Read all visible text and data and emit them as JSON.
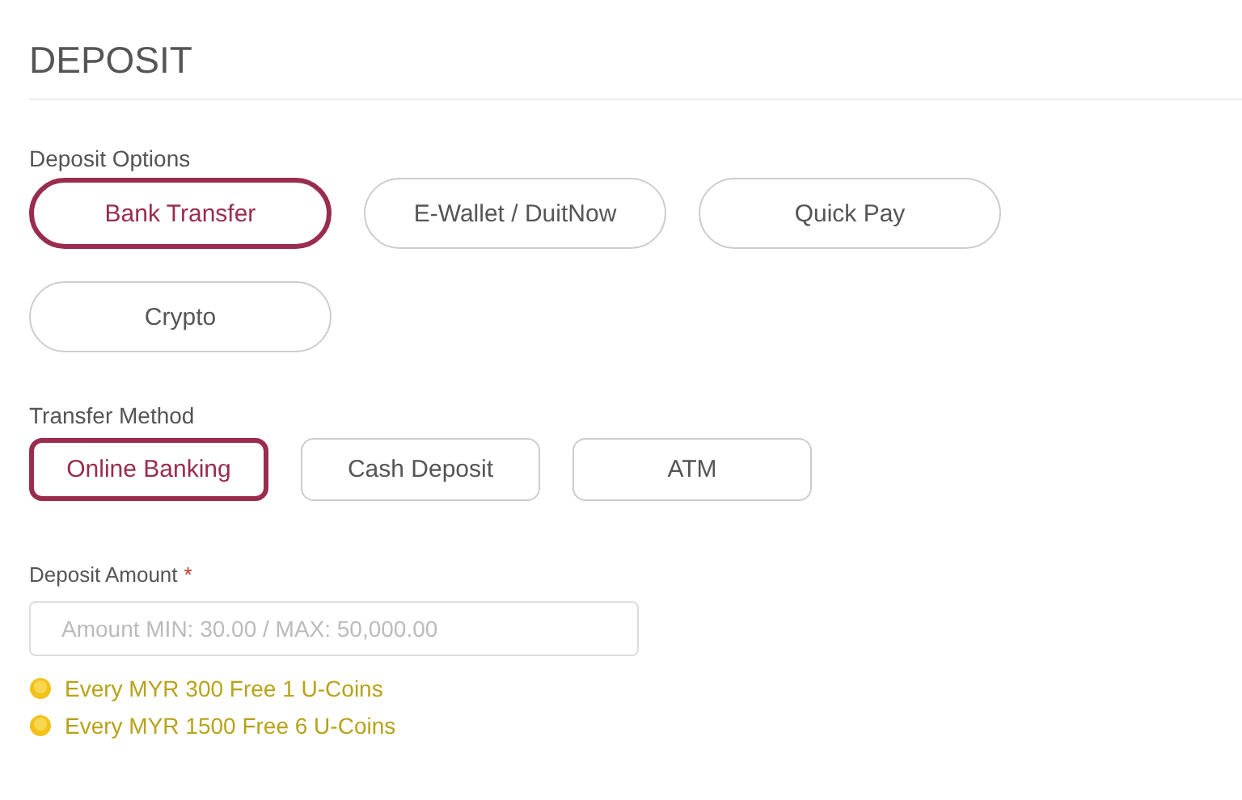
{
  "title": "DEPOSIT",
  "deposit_options": {
    "label": "Deposit Options",
    "options": [
      {
        "label": "Bank Transfer",
        "selected": true
      },
      {
        "label": "E-Wallet / DuitNow",
        "selected": false
      },
      {
        "label": "Quick Pay",
        "selected": false
      },
      {
        "label": "Crypto",
        "selected": false
      }
    ]
  },
  "transfer_method": {
    "label": "Transfer Method",
    "options": [
      {
        "label": "Online Banking",
        "selected": true
      },
      {
        "label": "Cash Deposit",
        "selected": false
      },
      {
        "label": "ATM",
        "selected": false
      }
    ]
  },
  "deposit_amount": {
    "label": "Deposit Amount",
    "required_mark": "*",
    "placeholder": "Amount MIN: 30.00 / MAX: 50,000.00"
  },
  "promotions": [
    "Every MYR 300 Free 1 U-Coins",
    "Every MYR 1500 Free 6 U-Coins"
  ]
}
